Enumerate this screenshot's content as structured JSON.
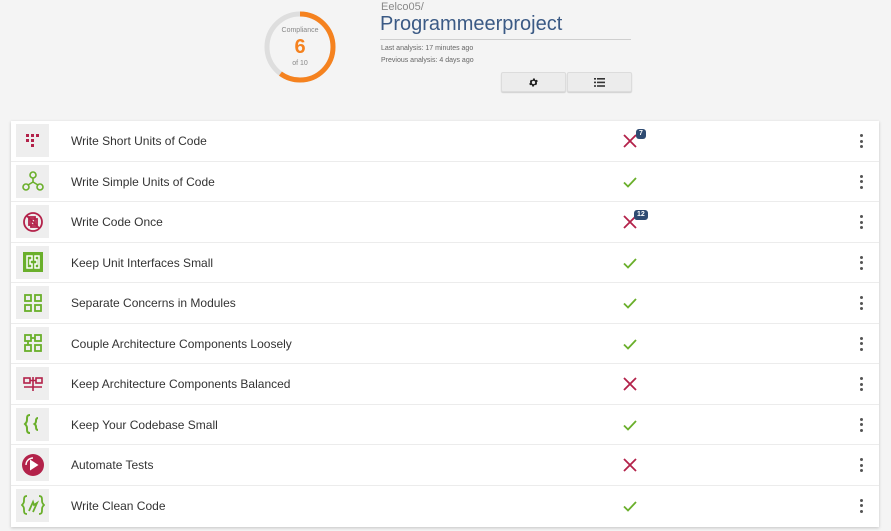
{
  "colors": {
    "accent_orange": "#f5821f",
    "pass_green": "#6aaf2b",
    "fail_red": "#b3224a",
    "title_blue": "#3b5a85",
    "badge_navy": "#2f4b72"
  },
  "compliance": {
    "label": "Compliance",
    "score": "6",
    "of": "of 10",
    "fraction": 0.6
  },
  "project": {
    "owner": "Eelco05/",
    "name": "Programmeerproject",
    "last_analysis": "Last analysis: 17 minutes ago",
    "previous_analysis": "Previous analysis: 4 days ago"
  },
  "toolbar": {
    "settings_icon": "gear-icon",
    "list_icon": "list-icon"
  },
  "guidelines": [
    {
      "label": "Write Short Units of Code",
      "icon": "short-units-icon",
      "status": "fail",
      "badge": "7"
    },
    {
      "label": "Write Simple Units of Code",
      "icon": "simple-units-icon",
      "status": "pass",
      "badge": ""
    },
    {
      "label": "Write Code Once",
      "icon": "code-once-icon",
      "status": "fail",
      "badge": "12"
    },
    {
      "label": "Keep Unit Interfaces Small",
      "icon": "unit-interfaces-icon",
      "status": "pass",
      "badge": ""
    },
    {
      "label": "Separate Concerns in Modules",
      "icon": "modules-icon",
      "status": "pass",
      "badge": ""
    },
    {
      "label": "Couple Architecture Components Loosely",
      "icon": "components-loose-icon",
      "status": "pass",
      "badge": ""
    },
    {
      "label": "Keep Architecture Components Balanced",
      "icon": "components-balanced-icon",
      "status": "fail",
      "badge": ""
    },
    {
      "label": "Keep Your Codebase Small",
      "icon": "codebase-small-icon",
      "status": "pass",
      "badge": ""
    },
    {
      "label": "Automate Tests",
      "icon": "automate-tests-icon",
      "status": "fail",
      "badge": ""
    },
    {
      "label": "Write Clean Code",
      "icon": "clean-code-icon",
      "status": "pass",
      "badge": ""
    }
  ]
}
